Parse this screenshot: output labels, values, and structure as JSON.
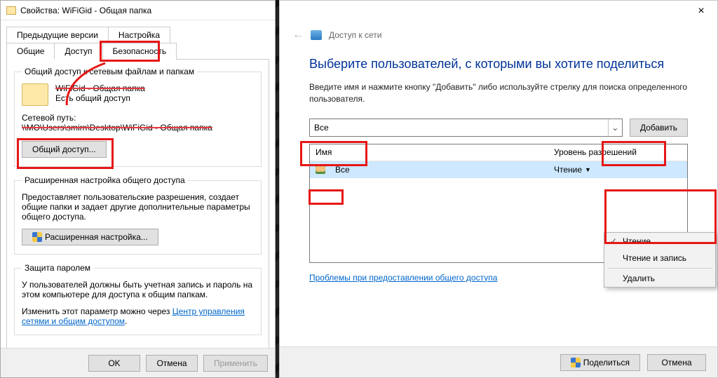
{
  "properties": {
    "title": "Свойства: WiFiGid - Общая папка",
    "tabs_row1": [
      "Предыдущие версии",
      "Настройка"
    ],
    "tabs_row2": [
      "Общие",
      "Доступ",
      "Безопасность"
    ],
    "active_tab": "Доступ",
    "share_section": {
      "legend": "Общий доступ к сетевым файлам и папкам",
      "name": "WiFiGid - Общая папка",
      "status": "Есть общий доступ",
      "path_label": "Сетевой путь:",
      "path": "\\\\MO\\Users\\smirn\\Desktop\\WiFiGid - Общая папка",
      "button": "Общий доступ..."
    },
    "advanced_section": {
      "legend": "Расширенная настройка общего доступа",
      "desc": "Предоставляет пользовательские разрешения, создает общие папки и задает другие дополнительные параметры общего доступа.",
      "button": "Расширенная настройка..."
    },
    "password_section": {
      "legend": "Защита паролем",
      "desc": "У пользователей должны быть учетная запись и пароль на этом компьютере для доступа к общим папкам.",
      "link_before": "Изменить этот параметр можно через ",
      "link": "Центр управления сетями и общим доступом"
    },
    "footer": {
      "ok": "OK",
      "cancel": "Отмена",
      "apply": "Применить"
    }
  },
  "wizard": {
    "crumb": "Доступ к сети",
    "heading": "Выберите пользователей, с которыми вы хотите поделиться",
    "hint": "Введите имя и нажмите кнопку \"Добавить\" либо используйте стрелку для поиска определенного пользователя.",
    "combo_value": "Все",
    "add": "Добавить",
    "col_name": "Имя",
    "col_perm": "Уровень разрешений",
    "rows": [
      {
        "name": "Все",
        "perm": "Чтение"
      }
    ],
    "menu": {
      "read": "Чтение",
      "readwrite": "Чтение и запись",
      "remove": "Удалить"
    },
    "trouble_link": "Проблемы при предоставлении общего доступа",
    "footer": {
      "share": "Поделиться",
      "cancel": "Отмена"
    }
  }
}
